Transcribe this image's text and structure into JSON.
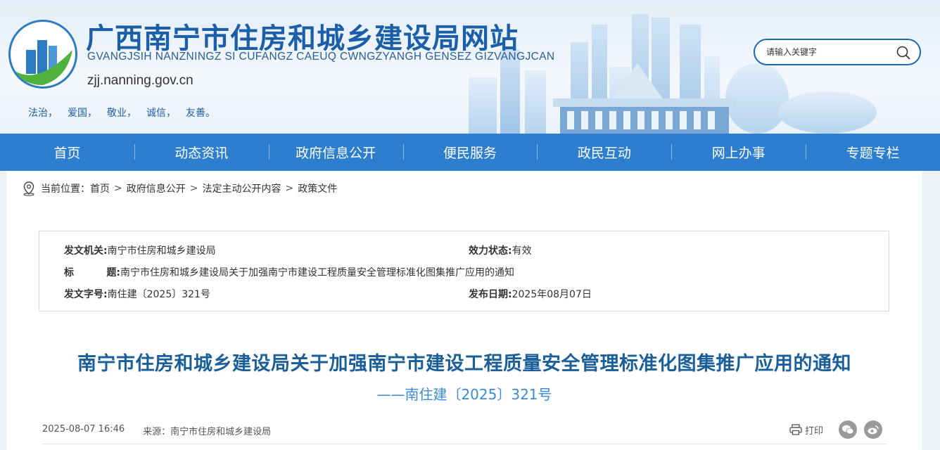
{
  "header": {
    "title": "广西南宁市住房和城乡建设局网站",
    "subtitle": "GVANGJSIH NANZNINGZ SI CUFANGZ CAEUQ CWNGZYANGH GENSEZ GIZVANGJCAN",
    "domain": "zjj.nanning.gov.cn",
    "slogans": [
      "法治，",
      "爱国，",
      "敬业，",
      "诚信，",
      "友善。"
    ],
    "search_placeholder": "请输入关键字"
  },
  "nav": {
    "items": [
      "首页",
      "动态资讯",
      "政府信息公开",
      "便民服务",
      "政民互动",
      "网上办事",
      "专题专栏"
    ]
  },
  "breadcrumb": {
    "prefix": "当前位置：",
    "items": [
      "首页",
      "政府信息公开",
      "法定主动公开内容",
      "政策文件"
    ],
    "sep": ">"
  },
  "info": {
    "issuer_label": "发文机关:",
    "issuer": "南宁市住房和城乡建设局",
    "status_label": "效力状态:",
    "status": "有效",
    "title_label_1": "标",
    "title_label_2": "题:",
    "title": "南宁市住房和城乡建设局关于加强南宁市建设工程质量安全管理标准化图集推广应用的通知",
    "number_label": "发文字号:",
    "number": "南住建〔2025〕321号",
    "date_label": "发布日期:",
    "date": "2025年08月07日"
  },
  "article": {
    "title": "南宁市住房和城乡建设局关于加强南宁市建设工程质量安全管理标准化图集推广应用的通知",
    "subtitle": "——南住建〔2025〕321号",
    "time": "2025-08-07 16:46",
    "source": "来源：南宁市住房和城乡建设局",
    "print_label": "打印"
  },
  "colors": {
    "nav_bg": "#2e7ed0",
    "title_color": "#1b5f99",
    "subtitle_color": "#3a8bd0"
  }
}
